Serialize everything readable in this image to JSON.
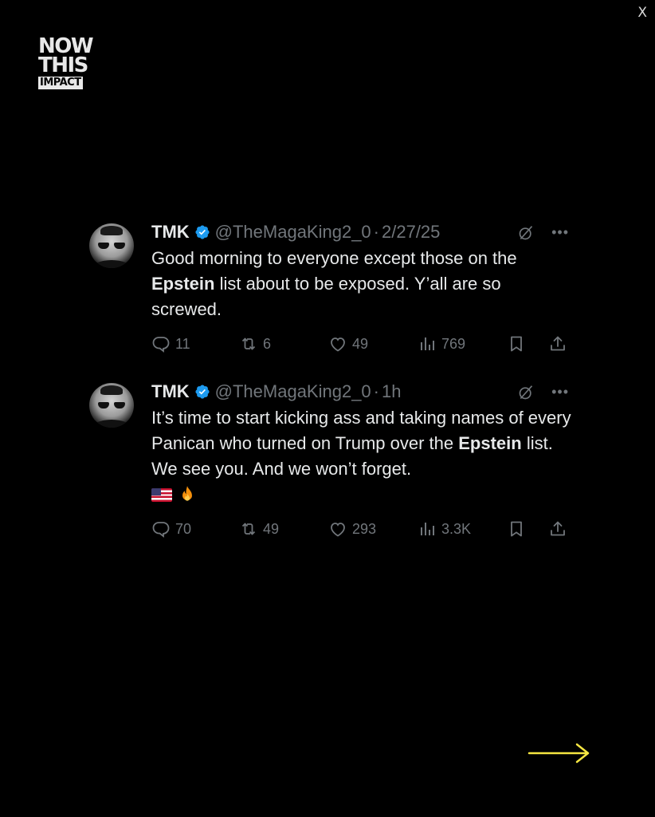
{
  "close_label": "X",
  "brand": {
    "line1": "NOW",
    "line2": "THIS",
    "line3": "IMPACT"
  },
  "tweets": [
    {
      "name": "TMK",
      "handle": "@TheMagaKing2_0",
      "separator": "·",
      "time": "2/27/25",
      "text_before": "Good morning to everyone except those on the ",
      "text_bold": "Epstein",
      "text_after": " list about to be exposed. Y’all are so screwed.",
      "emoji": [],
      "replies": "11",
      "reposts": "6",
      "likes": "49",
      "views": "769"
    },
    {
      "name": "TMK",
      "handle": "@TheMagaKing2_0",
      "separator": "·",
      "time": "1h",
      "text_before": "It’s time to start kicking ass and taking names of every Panican who turned on Trump over the ",
      "text_bold": "Epstein",
      "text_after": " list. We see you. And we won’t forget.",
      "emoji": [
        "us-flag",
        "fire"
      ],
      "replies": "70",
      "reposts": "49",
      "likes": "293",
      "views": "3.3K"
    }
  ],
  "colors": {
    "background": "#000000",
    "text": "#e7e9ea",
    "muted": "#71767b",
    "verified": "#1d9bf0",
    "arrow": "#f5e642"
  }
}
